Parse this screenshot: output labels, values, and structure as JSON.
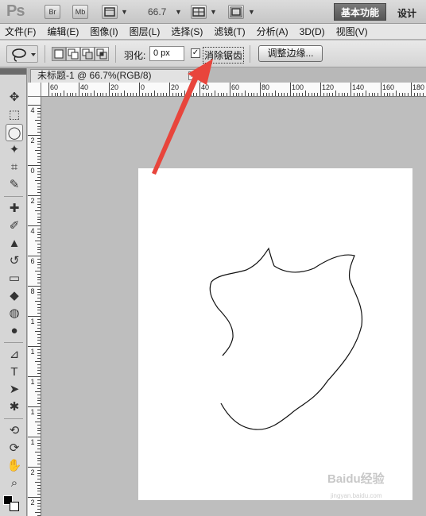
{
  "appbar": {
    "logo": "Ps",
    "bridge_button": "Br",
    "minibridge_button": "Mb",
    "zoom_value": "66.7",
    "workspace_active": "基本功能",
    "workspace_design": "设计"
  },
  "menu": {
    "items": [
      {
        "label": "文件(F)"
      },
      {
        "label": "编辑(E)"
      },
      {
        "label": "图像(I)"
      },
      {
        "label": "图层(L)"
      },
      {
        "label": "选择(S)"
      },
      {
        "label": "滤镜(T)"
      },
      {
        "label": "分析(A)"
      },
      {
        "label": "3D(D)"
      },
      {
        "label": "视图(V)"
      }
    ]
  },
  "options": {
    "feather_label": "羽化:",
    "feather_value": "0 px",
    "antialias_checked": true,
    "antialias_mark": "✓",
    "antialias_label": "消除锯齿",
    "refine_edge_label": "调整边缘..."
  },
  "document_tab": {
    "title": "未标题-1 @ 66.7%(RGB/8)",
    "close_glyph": "×"
  },
  "ruler_top": {
    "labels": [
      "60",
      "40",
      "20",
      "0",
      "20",
      "40",
      "60",
      "80",
      "100",
      "120",
      "140",
      "160",
      "180"
    ]
  },
  "ruler_left": {
    "labels": [
      "4",
      "2",
      "0",
      "2",
      "4",
      "6",
      "8",
      "1",
      "1",
      "1",
      "1",
      "1",
      "2",
      "2"
    ]
  },
  "toolbox": {
    "tools": [
      {
        "name": "move-tool-icon",
        "glyph": "✥"
      },
      {
        "name": "marquee-tool-icon",
        "glyph": "⬚"
      },
      {
        "name": "lasso-tool-icon",
        "glyph": "◯",
        "active": true
      },
      {
        "name": "magic-wand-tool-icon",
        "glyph": "✦"
      },
      {
        "name": "crop-tool-icon",
        "glyph": "⌗"
      },
      {
        "name": "eyedropper-tool-icon",
        "glyph": "✎"
      },
      {
        "name": "healing-brush-tool-icon",
        "glyph": "✚"
      },
      {
        "name": "brush-tool-icon",
        "glyph": "✐"
      },
      {
        "name": "clone-stamp-tool-icon",
        "glyph": "▲"
      },
      {
        "name": "history-brush-tool-icon",
        "glyph": "↺"
      },
      {
        "name": "eraser-tool-icon",
        "glyph": "▭"
      },
      {
        "name": "paint-bucket-tool-icon",
        "glyph": "◆"
      },
      {
        "name": "blur-tool-icon",
        "glyph": "◍"
      },
      {
        "name": "dodge-tool-icon",
        "glyph": "●"
      },
      {
        "name": "pen-tool-icon",
        "glyph": "⊿"
      },
      {
        "name": "type-tool-icon",
        "glyph": "T"
      },
      {
        "name": "path-selection-tool-icon",
        "glyph": "➤"
      },
      {
        "name": "shape-tool-icon",
        "glyph": "✱"
      },
      {
        "name": "3d-rotate-tool-icon",
        "glyph": "⟲"
      },
      {
        "name": "3d-orbit-tool-icon",
        "glyph": "⟳"
      },
      {
        "name": "hand-tool-icon",
        "glyph": "✋"
      },
      {
        "name": "zoom-tool-icon",
        "glyph": "⌕"
      }
    ]
  },
  "watermark": {
    "text": "Baidu经验",
    "sub": "jingyan.baidu.com"
  },
  "colors": {
    "arrow": "#e8453c",
    "canvas_bg": "#bebebe",
    "document_bg": "#ffffff"
  }
}
